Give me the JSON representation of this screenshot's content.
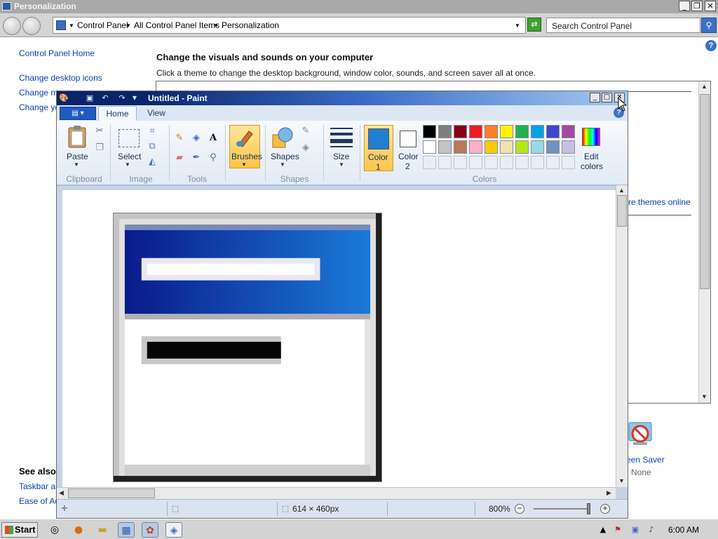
{
  "control_panel": {
    "title": "Personalization",
    "breadcrumbs": [
      "Control Panel",
      "All Control Panel Items",
      "Personalization"
    ],
    "search_placeholder": "Search Control Panel",
    "left_links": [
      "Control Panel Home",
      "Change desktop icons",
      "Change mo",
      "Change yo"
    ],
    "see_also_heading": "See also",
    "see_also_links": [
      "Taskbar ar",
      "Ease of Ac"
    ],
    "heading": "Change the visuals and sounds on your computer",
    "subtext": "Click a theme to change the desktop background, window color, sounds, and screen saver all at once.",
    "themes_online_link": "re themes online",
    "screen_saver_label": "een Saver",
    "screen_saver_value": "None"
  },
  "paint": {
    "title": "Untitled - Paint",
    "tabs": [
      "Home",
      "View"
    ],
    "buttons": {
      "paste": "Paste",
      "select": "Select",
      "brushes": "Brushes",
      "shapes": "Shapes",
      "size": "Size",
      "color1_line1": "Color",
      "color1_line2": "1",
      "color2_line1": "Color",
      "color2_line2": "2",
      "edit_colors_line1": "Edit",
      "edit_colors_line2": "colors"
    },
    "group_labels": [
      "Clipboard",
      "Image",
      "Tools",
      "Shapes",
      "Colors"
    ],
    "palette_row1": [
      "#000000",
      "#7f7f7f",
      "#880015",
      "#ed1c24",
      "#ff7f27",
      "#fff200",
      "#22b14c",
      "#00a2e8",
      "#3f48cc",
      "#a349a4"
    ],
    "palette_row2": [
      "#ffffff",
      "#c3c3c3",
      "#b97a57",
      "#ffaec9",
      "#ffc90e",
      "#efe4b0",
      "#b5e61d",
      "#99d9ea",
      "#7092be",
      "#c8bfe7"
    ],
    "color1": "#1f7fd4",
    "color2": "#ffffff",
    "status": {
      "image_size": "614 × 460px",
      "zoom": "800%"
    }
  },
  "taskbar": {
    "start_label": "Start",
    "clock": "6:00 AM"
  },
  "colors": {
    "accent_blue": "#0a246a",
    "link_blue": "#0a3fb0"
  }
}
